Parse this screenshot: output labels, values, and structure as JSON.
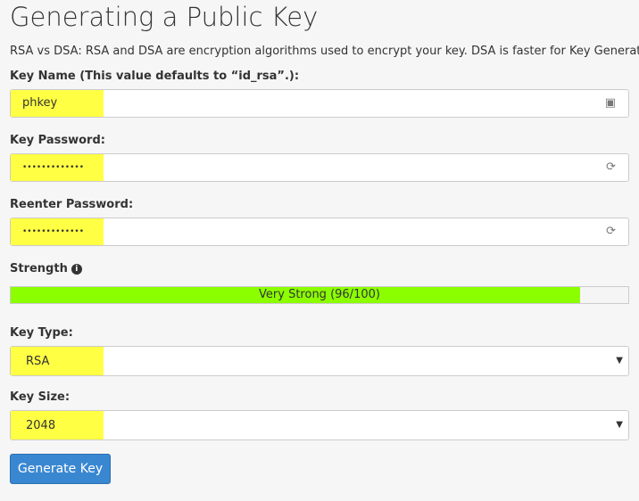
{
  "title": "Generating a Public Key",
  "description": "RSA vs DSA: RSA and DSA are encryption algorithms used to encrypt your key. DSA is faster for Key Generation",
  "key_name": {
    "label": "Key Name (This value defaults to “id_rsa”.):",
    "value": "phkey",
    "icon": "contact-card-icon"
  },
  "key_password": {
    "label": "Key Password:",
    "value": "•••••••••••••",
    "icon": "password-generator-icon"
  },
  "reenter_password": {
    "label": "Reenter Password:",
    "value": "•••••••••••••",
    "icon": "password-generator-icon"
  },
  "strength": {
    "label": "Strength",
    "icon": "info-icon",
    "text": "Very Strong (96/100)",
    "percent": 96,
    "color": "#8bff00"
  },
  "key_type": {
    "label": "Key Type:",
    "value": "RSA"
  },
  "key_size": {
    "label": "Key Size:",
    "value": "2048"
  },
  "generate_button": "Generate Key",
  "highlight_color": "#ffff44"
}
